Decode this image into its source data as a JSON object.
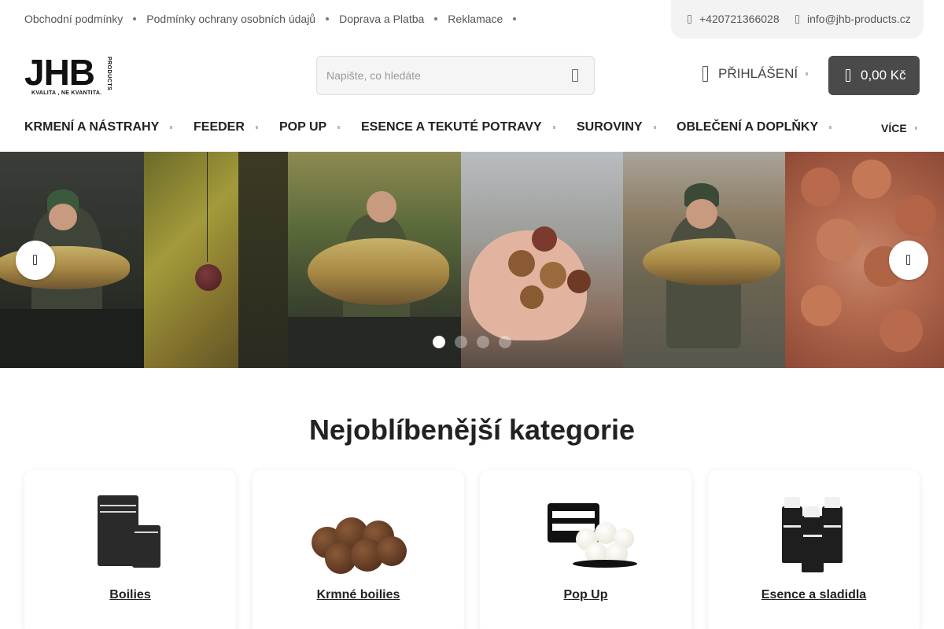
{
  "topbar": {
    "links": [
      "Obchodní podmínky",
      "Podmínky ochrany osobních údajů",
      "Doprava a Platba",
      "Reklamace"
    ],
    "phone": "+420721366028",
    "email": "info@jhb-products.cz"
  },
  "header": {
    "logo_main": "JHB",
    "logo_products": "PRODUCTS",
    "logo_tagline": "KVALITA , NE KVANTITA.",
    "search_placeholder": "Napište, co hledáte",
    "login_label": "PŘIHLÁŠENÍ",
    "cart_total": "0,00 Kč"
  },
  "nav": {
    "items": [
      "KRMENÍ A NÁSTRAHY",
      "FEEDER",
      "POP UP",
      "ESENCE A TEKUTÉ POTRAVY",
      "SUROVINY",
      "OBLEČENÍ A DOPLŇKY"
    ],
    "more_label": "VÍCE"
  },
  "hero": {
    "slides_count": 4,
    "active_slide": 1
  },
  "categories": {
    "title": "Nejoblíbenější kategorie",
    "items": [
      {
        "label": "Boilies"
      },
      {
        "label": "Krmné boilies"
      },
      {
        "label": "Pop Up"
      },
      {
        "label": "Esence a sladidla"
      }
    ]
  },
  "icons": {
    "phone": "phone-icon",
    "email": "email-icon",
    "search": "search-icon",
    "user": "user-icon",
    "cart": "cart-icon",
    "prev": "chevron-left-icon",
    "next": "chevron-right-icon"
  },
  "colors": {
    "cart_bg": "#4a4a4a",
    "contact_bg": "#f3f3f3",
    "text": "#222222"
  }
}
